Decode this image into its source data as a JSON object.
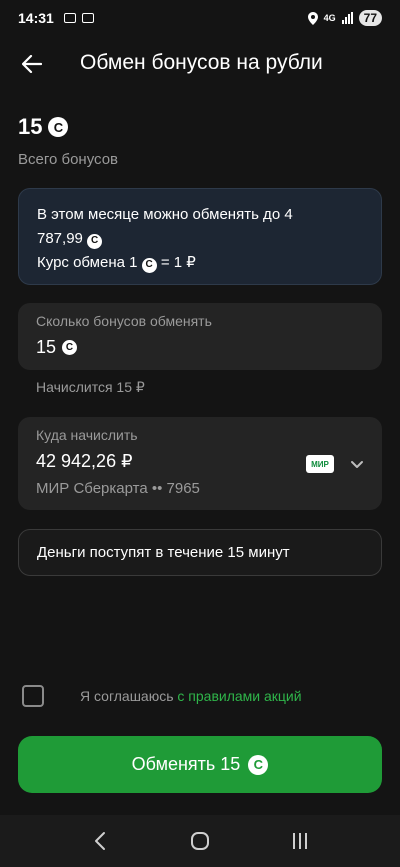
{
  "status_bar": {
    "time": "14:31",
    "network": "4G",
    "battery": "77"
  },
  "header": {
    "title": "Обмен бонусов на рубли"
  },
  "bonus_summary": {
    "amount": "15",
    "caption": "Всего бонусов"
  },
  "coin_symbol": "C",
  "info": {
    "limit_line1": "В этом месяце можно обменять до 4",
    "limit_line2": "787,99",
    "rate_prefix": "Курс обмена 1",
    "rate_suffix": "= 1 ₽"
  },
  "exchange_field": {
    "label": "Сколько бонусов обменять",
    "value": "15"
  },
  "accrual_hint": "Начислится 15 ₽",
  "destination": {
    "label": "Куда начислить",
    "balance": "42 942,26 ₽",
    "card_name": "МИР Сберкарта •• 7965",
    "card_brand": "МИР"
  },
  "notice": "Деньги поступят в течение 15 минут",
  "agreement": {
    "text": "Я соглашаюсь ",
    "link": "с правилами акций",
    "checked": false
  },
  "submit": {
    "label": "Обменять 15"
  },
  "colors": {
    "background": "#141414",
    "accent_green": "#1f9b37",
    "link_green": "#2fb54a",
    "info_card": "#1d2633"
  }
}
